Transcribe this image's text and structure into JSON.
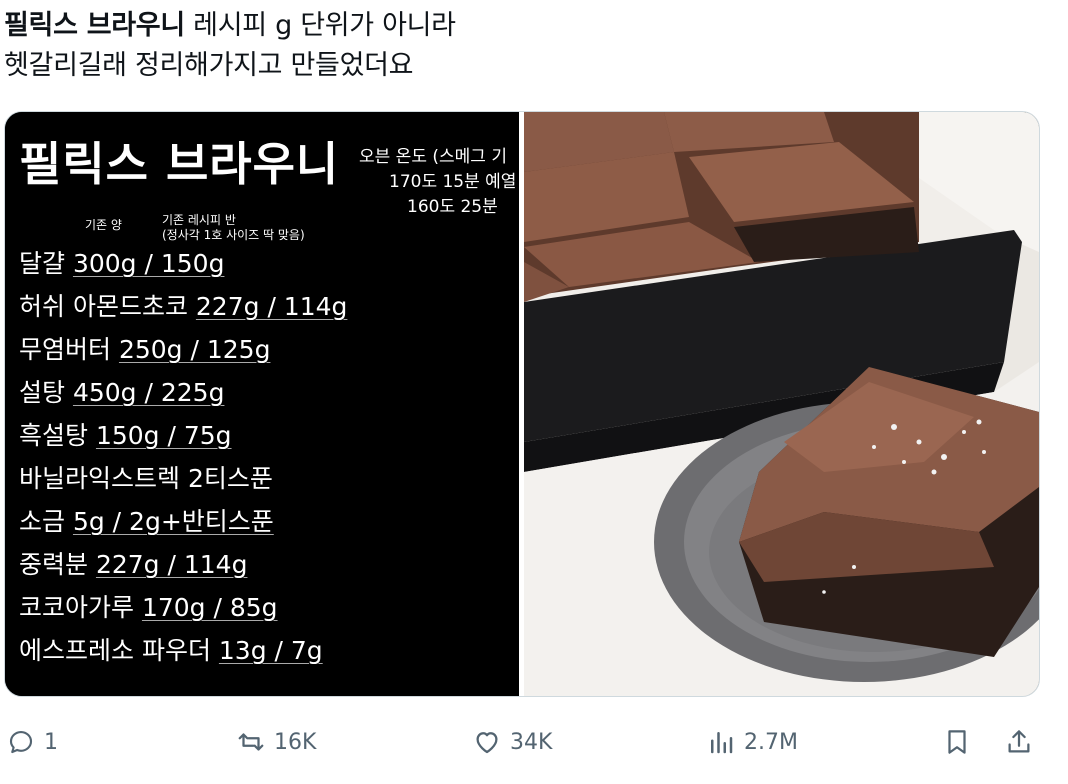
{
  "tweet": {
    "text_bold": "필릭스 브라우니",
    "text_rest": " 레시피 g 단위가 아니라",
    "text_line2": "헷갈리길래 정리해가지고 만들었더요"
  },
  "recipe_card": {
    "title": "필릭스 브라우니",
    "oven_line1": "오븐 온도 (스메그 기",
    "oven_line2": "170도 15분 예열",
    "oven_line3": "160도 25분",
    "header_base": "기존 양",
    "header_half": "기존 레시피 반",
    "header_half_note": "(정사각 1호 사이즈 딱 맞음)",
    "items": [
      {
        "name": "달걀 ",
        "qty": "300g / 150g"
      },
      {
        "name": "허쉬 아몬드초코 ",
        "qty": "227g / 114g"
      },
      {
        "name": "무염버터 ",
        "qty": "250g / 125g"
      },
      {
        "name": "설탕 ",
        "qty": "450g / 225g"
      },
      {
        "name": "흑설탕 ",
        "qty": "150g / 75g"
      },
      {
        "name": "바닐라익스트렉 2티스푼",
        "qty": ""
      },
      {
        "name": "소금 ",
        "qty": "5g / 2g+반티스푼"
      },
      {
        "name": "중력분 ",
        "qty": "227g / 114g"
      },
      {
        "name": "코코아가루 ",
        "qty": "170g / 85g"
      },
      {
        "name": "에스프레소 파우더 ",
        "qty": "13g / 7g"
      }
    ]
  },
  "photo": {
    "alt": "brownie photo",
    "colors": {
      "crust": "#8a5a47",
      "crumb": "#2a1d18",
      "pan": "#1a1a1c",
      "plate": "#7b7b7d",
      "paper": "#f1eeea"
    }
  },
  "actions": {
    "reply_count": "1",
    "retweet_count": "16K",
    "like_count": "34K",
    "views_count": "2.7M"
  },
  "colors": {
    "text": "#0f1419",
    "muted": "#536471",
    "border": "#cfd9de"
  }
}
